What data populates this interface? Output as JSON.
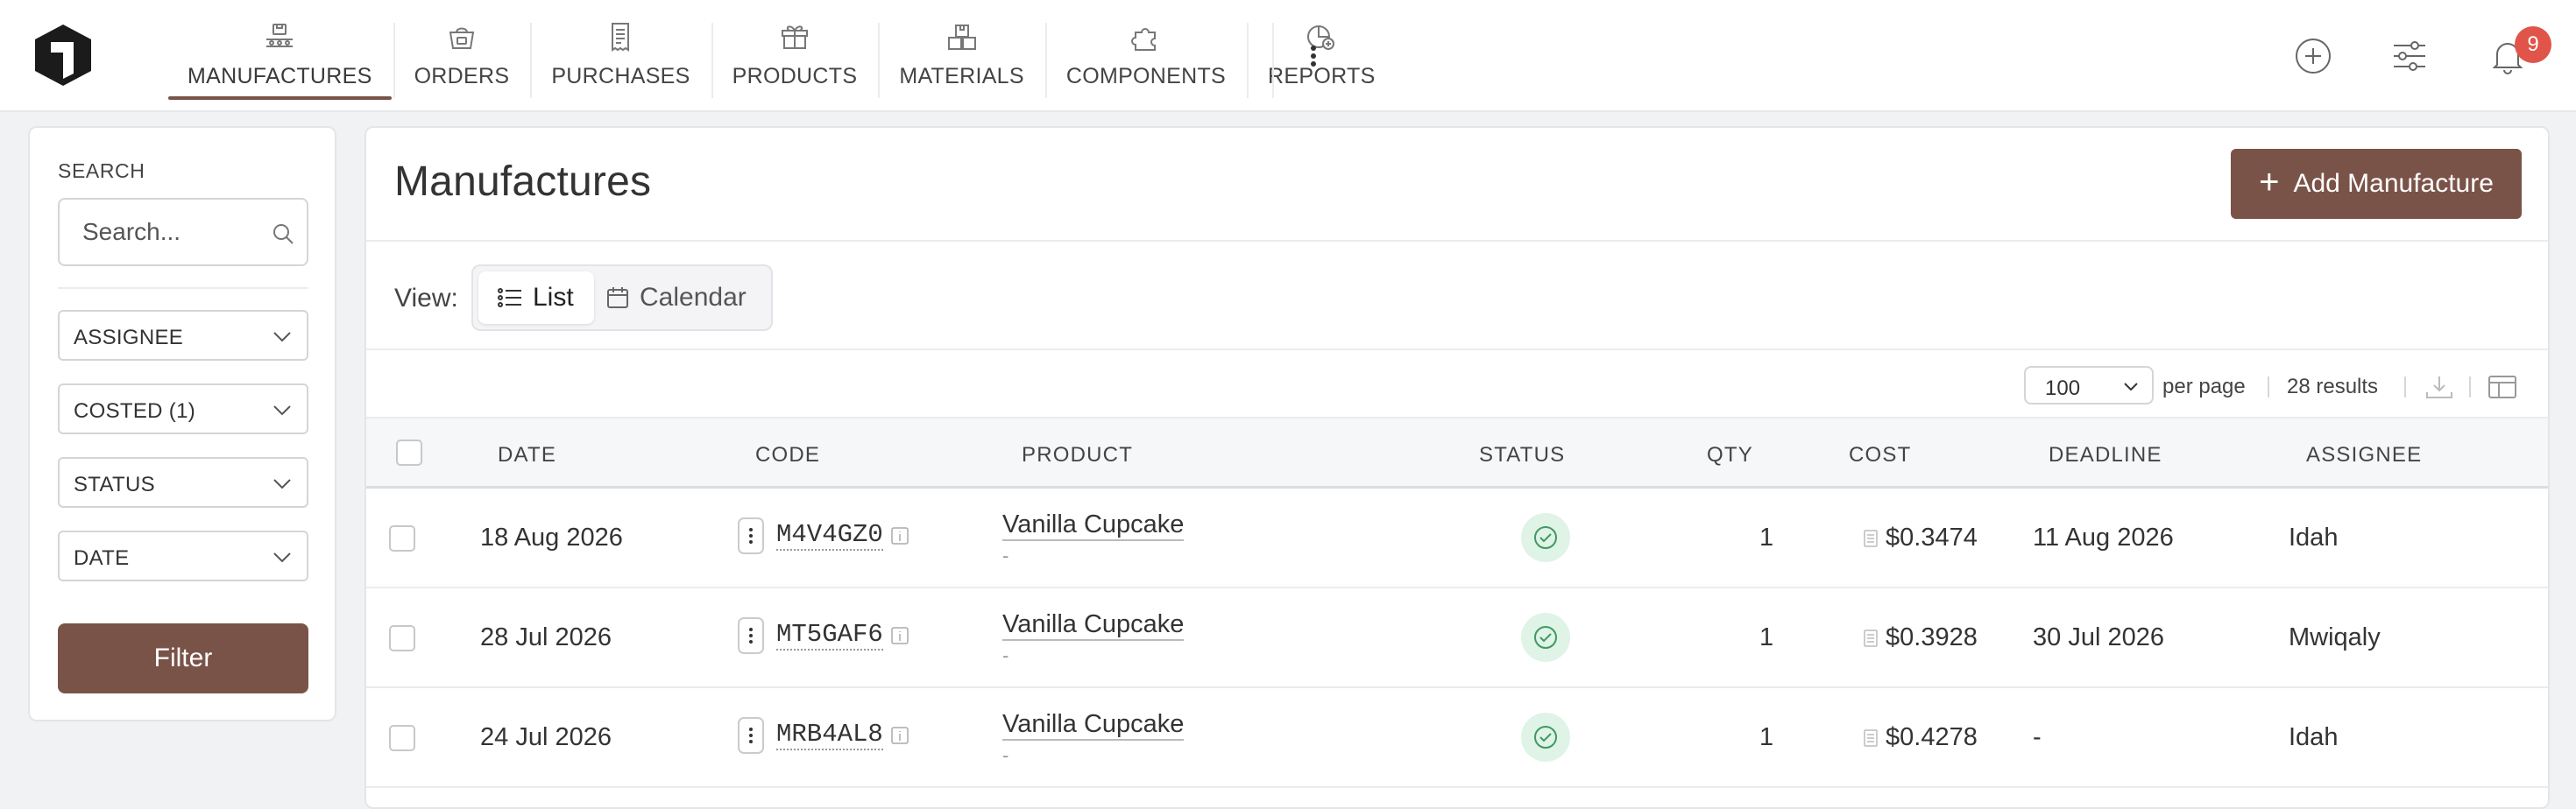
{
  "nav": {
    "tabs": [
      {
        "label": "MANUFACTURES",
        "icon": "manufactures-icon",
        "active": true
      },
      {
        "label": "ORDERS",
        "icon": "orders-icon"
      },
      {
        "label": "PURCHASES",
        "icon": "purchases-icon"
      },
      {
        "label": "PRODUCTS",
        "icon": "products-icon"
      },
      {
        "label": "MATERIALS",
        "icon": "materials-icon"
      },
      {
        "label": "COMPONENTS",
        "icon": "components-icon"
      },
      {
        "label": "REPORTS",
        "icon": "reports-icon"
      }
    ],
    "notification_count": "9"
  },
  "sidebar": {
    "search_label": "SEARCH",
    "search_placeholder": "Search...",
    "filters": [
      "ASSIGNEE",
      "COSTED (1)",
      "STATUS",
      "DATE"
    ],
    "filter_button": "Filter"
  },
  "main": {
    "title": "Manufactures",
    "add_button": "Add Manufacture",
    "view_label": "View:",
    "view_options": [
      "List",
      "Calendar"
    ],
    "per_page": "100",
    "per_page_label": "per page",
    "results": "28 results"
  },
  "table": {
    "columns": [
      "DATE",
      "CODE",
      "PRODUCT",
      "STATUS",
      "QTY",
      "COST",
      "DEADLINE",
      "ASSIGNEE"
    ],
    "rows": [
      {
        "date": "18 Aug 2026",
        "code": "M4V4GZ0",
        "product": "Vanilla Cupcake",
        "product_sub": "-",
        "status": "complete",
        "qty": "1",
        "cost": "$0.3474",
        "deadline": "11 Aug 2026",
        "assignee": "Idah"
      },
      {
        "date": "28 Jul 2026",
        "code": "MT5GAF6",
        "product": "Vanilla Cupcake",
        "product_sub": "-",
        "status": "complete",
        "qty": "1",
        "cost": "$0.3928",
        "deadline": "30 Jul 2026",
        "assignee": "Mwiqaly"
      },
      {
        "date": "24 Jul 2026",
        "code": "MRB4AL8",
        "product": "Vanilla Cupcake",
        "product_sub": "-",
        "status": "complete",
        "qty": "1",
        "cost": "$0.4278",
        "deadline": "-",
        "assignee": "Idah"
      }
    ]
  },
  "colors": {
    "brand": "#7a5348",
    "badge": "#e05449",
    "status_complete_bg": "#dff3e6",
    "status_complete_fg": "#3f9a5f"
  }
}
